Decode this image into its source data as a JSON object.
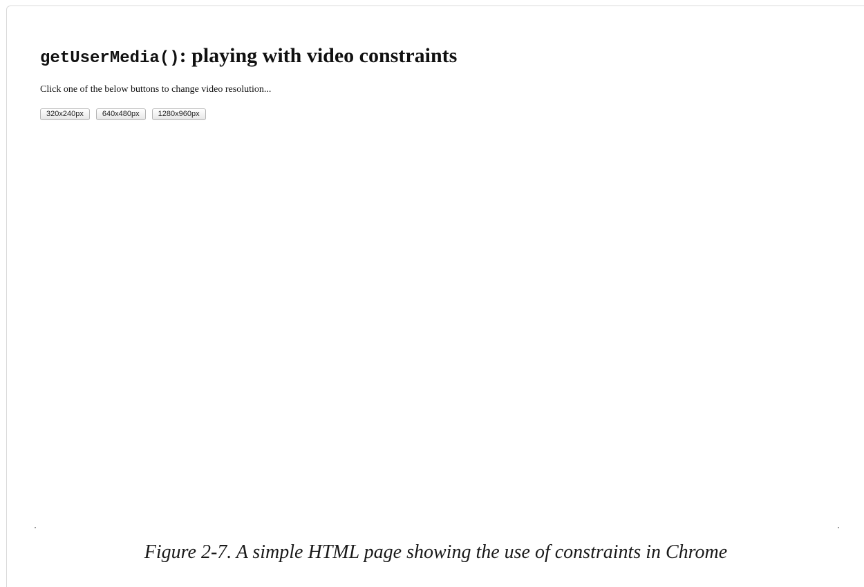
{
  "page": {
    "title_code": "getUserMedia()",
    "title_rest": ": playing with video constraints",
    "instructions": "Click one of the below buttons to change video resolution..."
  },
  "buttons": [
    {
      "label": "320x240px"
    },
    {
      "label": "640x480px"
    },
    {
      "label": "1280x960px"
    }
  ],
  "caption": "Figure 2-7. A simple HTML page showing the use of constraints in Chrome"
}
